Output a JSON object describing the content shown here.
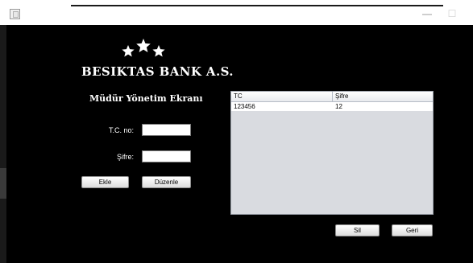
{
  "window": {
    "minimize_glyph": "—",
    "maximize_glyph": "☐"
  },
  "icons": {
    "app": "app-window-icon",
    "logo": "three-stars-logo"
  },
  "brand": {
    "name": "BESIKTAS BANK A.S."
  },
  "screen": {
    "title": "Müdür Yönetim Ekranı"
  },
  "form": {
    "tc_label": "T.C. no:",
    "tc_value": "",
    "sifre_label": "Şifre:",
    "sifre_value": "",
    "add_button": "Ekle",
    "edit_button": "Düzenle"
  },
  "table": {
    "headers": [
      "TC",
      "Şifre"
    ],
    "rows": [
      [
        "123456",
        "12"
      ]
    ]
  },
  "actions": {
    "delete_button": "Sil",
    "back_button": "Geri"
  },
  "colors": {
    "background": "#000000",
    "text": "#ffffff",
    "table_bg": "#d9dbe0"
  }
}
